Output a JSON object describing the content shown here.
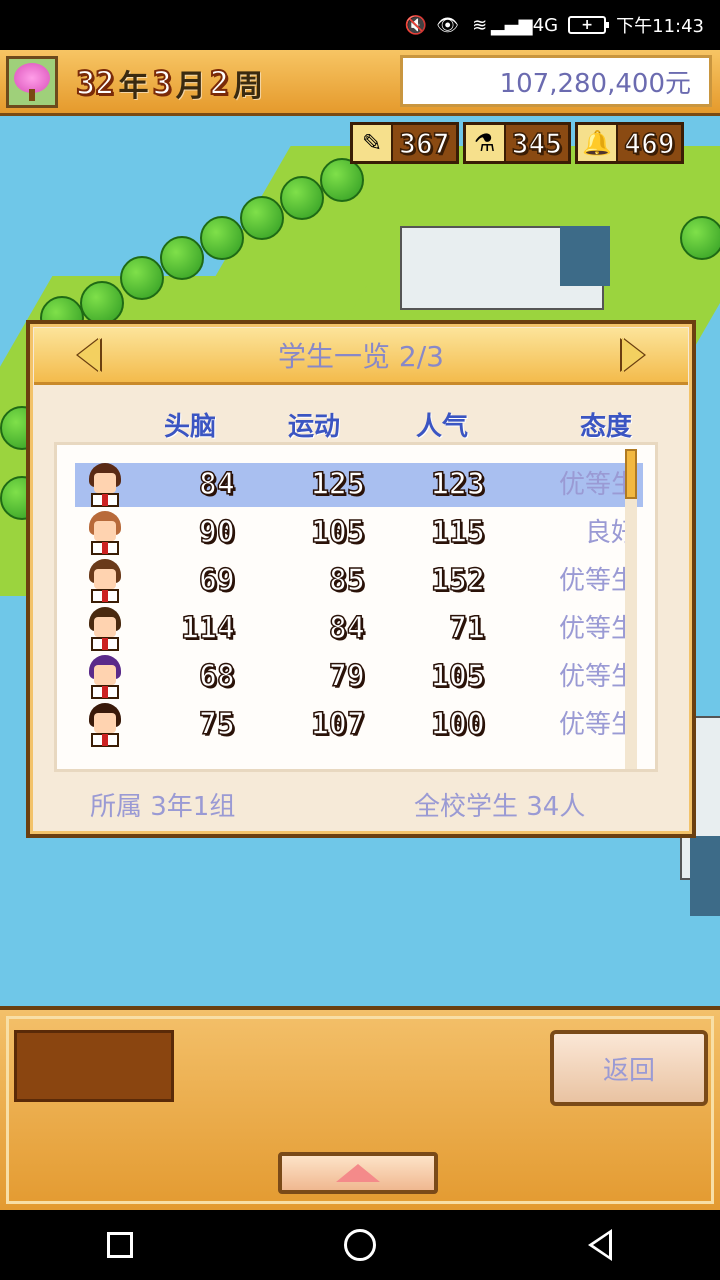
{
  "status_bar": {
    "signal_text": "4G",
    "battery_text": "+",
    "time": "下午11:43"
  },
  "top": {
    "date": {
      "year": "32",
      "year_unit": "年",
      "month": "3",
      "month_unit": "月",
      "week": "2",
      "week_unit": "周"
    },
    "money": "107,280,400元"
  },
  "resources": [
    {
      "icon": "pencil-icon",
      "value": "367"
    },
    {
      "icon": "flask-icon",
      "value": "345"
    },
    {
      "icon": "bell-icon",
      "value": "469"
    }
  ],
  "panel": {
    "title": "学生一览 2/3",
    "columns": [
      "头脑",
      "运动",
      "人气",
      "态度"
    ],
    "rows": [
      {
        "brain": "84",
        "sport": "125",
        "pop": "123",
        "attitude": "优等生",
        "selected": true,
        "hair": "#5a2a14"
      },
      {
        "brain": "90",
        "sport": "105",
        "pop": "115",
        "attitude": "良好",
        "selected": false,
        "hair": "#b86a3a"
      },
      {
        "brain": "69",
        "sport": "85",
        "pop": "152",
        "attitude": "优等生",
        "selected": false,
        "hair": "#6a3a1a"
      },
      {
        "brain": "114",
        "sport": "84",
        "pop": "71",
        "attitude": "优等生",
        "selected": false,
        "hair": "#4a2a10"
      },
      {
        "brain": "68",
        "sport": "79",
        "pop": "105",
        "attitude": "优等生",
        "selected": false,
        "hair": "#5a2a8a"
      },
      {
        "brain": "75",
        "sport": "107",
        "pop": "100",
        "attitude": "优等生",
        "selected": false,
        "hair": "#3a1a0a"
      }
    ],
    "footer_left": "所属 3年1组",
    "footer_right": "全校学生 34人"
  },
  "bottom": {
    "back_label": "返回"
  },
  "colors": {
    "accent": "#f3bb4c",
    "header_text": "#3b55c2",
    "muted_text": "#9a9ad4",
    "selected_row": "#a9bff0"
  }
}
